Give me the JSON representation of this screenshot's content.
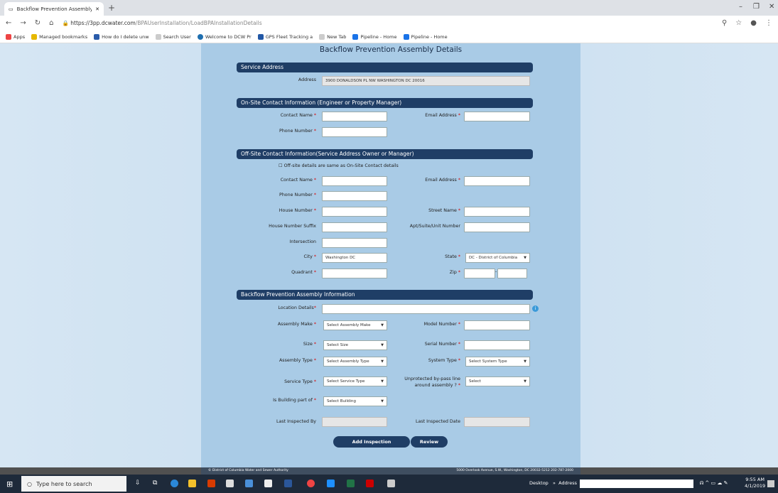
{
  "browser": {
    "tab_title": "Backflow Prevention Assembly D",
    "url_host": "https://3pp.dcwater.com",
    "url_path": "/BPAUserInstallation/LoadBPAInstallationDetails",
    "bookmarks": [
      "Apps",
      "Managed bookmarks",
      "How do I delete unw",
      "Search User",
      "Welcome to DCW Pr",
      "GPS Fleet Tracking a",
      "New Tab",
      "Pipeline - Home",
      "Pipeline - Home"
    ]
  },
  "page": {
    "title": "Backflow Prevention Assembly Details"
  },
  "service": {
    "header": "Service Address",
    "address_label": "Address",
    "address_value": "3900 DONALDSON PL NW WASHINGTON DC 20016"
  },
  "onsite": {
    "header": "On-Site Contact Information (Engineer or Property Manager)",
    "contact_name": "Contact Name",
    "email": "Email Address",
    "phone": "Phone Number"
  },
  "offsite": {
    "header": "Off-Site Contact Information(Service Address Owner or Manager)",
    "same_label": "Off-site details are same as On-Site Contact details",
    "contact_name": "Contact Name",
    "email": "Email Address",
    "phone": "Phone Number",
    "house_number": "House Number",
    "street_name": "Street Name",
    "house_suffix": "House Number Suffix",
    "apt": "Apt/Suite/Unit Number",
    "intersection": "Intersection",
    "city": "City",
    "city_value": "Washington DC",
    "state": "State",
    "state_value": "DC - District of Columbia",
    "quadrant": "Quadrant",
    "zip": "Zip"
  },
  "assembly": {
    "header": "Backflow Prevention Assembly Information",
    "location": "Location Details",
    "make": "Assembly Make",
    "make_value": "Select Assembly Make",
    "model": "Model Number",
    "size": "Size",
    "size_value": "Select Size",
    "serial": "Serial Number",
    "type": "Assembly Type",
    "type_value": "Select Assembly Type",
    "system": "System Type",
    "system_value": "Select System Type",
    "service_type": "Service Type",
    "service_type_value": "Select Service Type",
    "bypass_1": "Unprotected by-pass line",
    "bypass_2": "around assembly ?",
    "bypass_value": "Select",
    "building": "Is Building part of",
    "building_value": "Select Building",
    "last_by": "Last Inspected By",
    "last_date": "Last Inspected Date"
  },
  "buttons": {
    "add": "Add Inspection",
    "review": "Review"
  },
  "footer": {
    "left": "© District of Columbia Water and Sewer Authority",
    "right": "5000 Overlook Avenue, S.W., Washington, DC 20032-5212 202-787-2000"
  },
  "taskbar": {
    "search": "Type here to search",
    "desktop": "Desktop",
    "address": "Address",
    "time": "9:55 AM",
    "date": "4/1/2019"
  }
}
